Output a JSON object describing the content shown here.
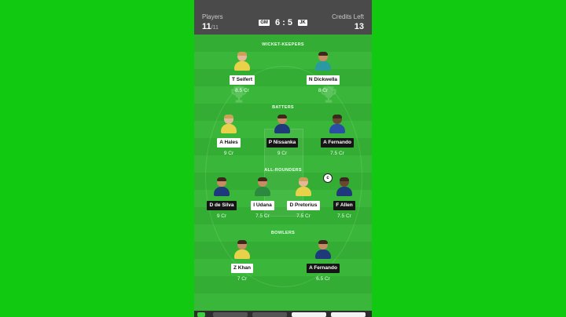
{
  "topbar": {
    "players_label": "Players",
    "players_count": "11",
    "players_total": "/11",
    "credits_label": "Credits Left",
    "credits_value": "13",
    "team1": "GM",
    "score": "6 : 5",
    "team2": "JK"
  },
  "sections": {
    "wicket_keepers": "WICKET-KEEPERS",
    "batters": "BATTERS",
    "all_rounders": "ALL-ROUNDERS",
    "bowlers": "BOWLERS"
  },
  "players": {
    "wk1": {
      "name": "T Seifert",
      "credit": "8.5 Cr"
    },
    "wk2": {
      "name": "N Dickwella",
      "credit": "8 Cr"
    },
    "bat1": {
      "name": "A Hales",
      "credit": "9 Cr"
    },
    "bat2": {
      "name": "P Nissanka",
      "credit": "9 Cr"
    },
    "bat3": {
      "name": "A Fernando",
      "credit": "7.5 Cr"
    },
    "ar1": {
      "name": "D de Silva",
      "credit": "9 Cr"
    },
    "ar2": {
      "name": "I Udana",
      "credit": "7.5 Cr"
    },
    "ar3": {
      "name": "D Pretorius",
      "credit": "7.5 Cr"
    },
    "ar4": {
      "name": "F Allen",
      "credit": "7.5 Cr"
    },
    "bowl1": {
      "name": "Z Khan",
      "credit": "7 Cr"
    },
    "bowl2": {
      "name": "A Fernando",
      "credit": "6.5 Cr"
    }
  },
  "captain_badge": "c",
  "colors": {
    "background": "#12c912",
    "field": "#34ad34",
    "topbar": "#4a4a4a"
  },
  "icons": [
    "trophy-icon",
    "player-avatar"
  ]
}
